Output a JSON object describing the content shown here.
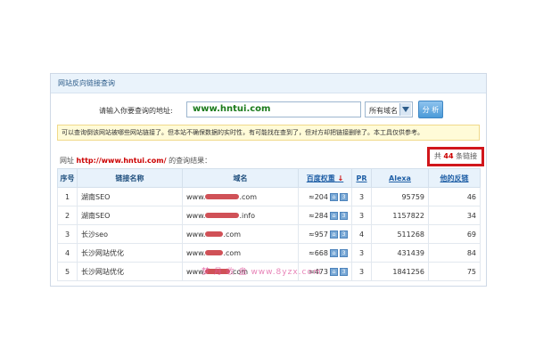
{
  "panel": {
    "title": "网站反向链接查询"
  },
  "search": {
    "label": "请输入你要查询的地址:",
    "value": "www.hntui.com",
    "domain_select": "所有域名",
    "analyze_button": "分 析"
  },
  "notice": "可以查询倒该网站被哪些网站链接了。但本站不确保数据的实时性，有可能找在查到了，但对方却把链接删除了。本工具仅供参考。",
  "result": {
    "prefix": "网址",
    "url": "http://www.hntui.com/",
    "suffix": "的查询结果：",
    "count_prefix": "共",
    "count": "44",
    "count_suffix": "条链接"
  },
  "table": {
    "headers": {
      "index": "序号",
      "link_name": "链接名称",
      "domain": "域名",
      "baidu_weight": "百度权重",
      "pr": "PR",
      "alexa": "Alexa",
      "backlinks": "他的反链"
    },
    "rows": [
      {
        "index": "1",
        "link_name": "湖南SEO",
        "domain_pre": "www.",
        "domain_post": ".com",
        "weight": "≈204",
        "weight_icon": "3",
        "pr": "3",
        "alexa": "95759",
        "backlinks": "46"
      },
      {
        "index": "2",
        "link_name": "湖南SEO",
        "domain_pre": "www.",
        "domain_post": ".info",
        "weight": "≈284",
        "weight_icon": "3",
        "pr": "3",
        "alexa": "1157822",
        "backlinks": "34"
      },
      {
        "index": "3",
        "link_name": "长沙seo",
        "domain_pre": "www.",
        "domain_post": ".com",
        "weight": "≈957",
        "weight_icon": "3",
        "pr": "4",
        "alexa": "511268",
        "backlinks": "69"
      },
      {
        "index": "4",
        "link_name": "长沙网站优化",
        "domain_pre": "www.",
        "domain_post": ".com",
        "weight": "≈668",
        "weight_icon": "3",
        "pr": "3",
        "alexa": "431439",
        "backlinks": "84"
      },
      {
        "index": "5",
        "link_name": "长沙网站优化",
        "domain_pre": "www.",
        "domain_post": ".com",
        "weight": "≈473",
        "weight_icon": "3",
        "pr": "3",
        "alexa": "1841256",
        "backlinks": "75"
      }
    ]
  },
  "watermark": "梦 月 收 盘   www.8yzx.com",
  "colors": {
    "accent": "#1f5fa6",
    "highlight_box": "#d1161b",
    "url_green": "#1a7a1a"
  }
}
